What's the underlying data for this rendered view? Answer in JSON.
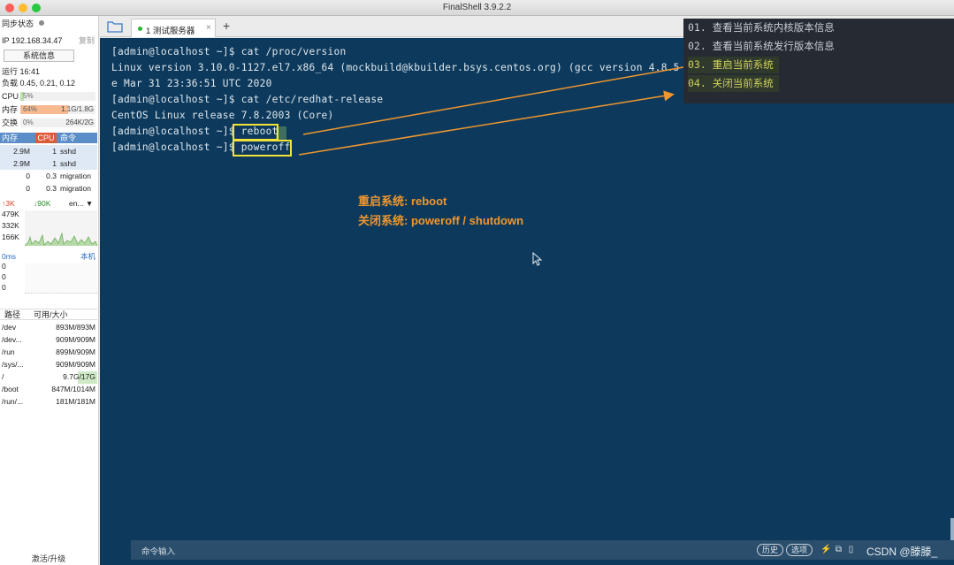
{
  "window": {
    "title": "FinalShell 3.9.2.2"
  },
  "sidebar": {
    "sync_status": "同步状态",
    "ip": "IP 192.168.34.47",
    "copy": "复制",
    "sysinfo_button": "系统信息",
    "uptime": "运行 16:41",
    "load": "负载 0.45, 0.21, 0.12",
    "cpu": {
      "label": "CPU",
      "pct": "5%",
      "value": 0.05
    },
    "mem": {
      "label": "内存",
      "pct": "64%",
      "amount": "1.1G/1.8G",
      "value": 0.64
    },
    "swap": {
      "label": "交换",
      "pct": "0%",
      "amount": "264K/2G",
      "value": 0.0
    },
    "proc_headers": [
      "内存",
      "CPU",
      "命令"
    ],
    "processes": [
      {
        "mem": "2.9M",
        "cpu": "1",
        "cmd": "sshd"
      },
      {
        "mem": "2.9M",
        "cpu": "1",
        "cmd": "sshd"
      },
      {
        "mem": "0",
        "cpu": "0.3",
        "cmd": "migration"
      },
      {
        "mem": "0",
        "cpu": "0.3",
        "cmd": "migration"
      }
    ],
    "net": {
      "up": "↑3K",
      "down": "↓90K",
      "iface": "en...",
      "levels": [
        "479K",
        "332K",
        "166K"
      ]
    },
    "ping": {
      "label": "0ms",
      "host": "本机",
      "levels": [
        "0",
        "0",
        "0"
      ]
    },
    "disk_headers": [
      "路径",
      "可用/大小"
    ],
    "disks": [
      {
        "path": "/dev",
        "size": "893M/893M"
      },
      {
        "path": "/dev...",
        "size": "909M/909M"
      },
      {
        "path": "/run",
        "size": "899M/909M"
      },
      {
        "path": "/sys/...",
        "size": "909M/909M"
      },
      {
        "path": "/",
        "size": "9.7G/17G"
      },
      {
        "path": "/boot",
        "size": "847M/1014M"
      },
      {
        "path": "/run/...",
        "size": "181M/181M"
      }
    ],
    "upgrade": "激活/升级"
  },
  "tabs": [
    {
      "label": "1 测试服务器",
      "status_color": "#2db52d"
    }
  ],
  "terminal": {
    "lines": [
      "[admin@localhost ~]$ cat /proc/version",
      "Linux version 3.10.0-1127.el7.x86_64 (mockbuild@kbuilder.bsys.centos.org) (gcc version 4.8.5 20",
      "e Mar 31 23:36:51 UTC 2020",
      "[admin@localhost ~]$ cat /etc/redhat-release",
      "CentOS Linux release 7.8.2003 (Core)",
      "[admin@localhost ~]$ reboot",
      "[admin@localhost ~]$ poweroff"
    ],
    "highlight_reboot": "reboot",
    "highlight_poweroff": "poweroff",
    "bg_color": "#0d3a5c"
  },
  "annotations": {
    "line1": "重启系统: reboot",
    "line2": "关闭系统: poweroff / shutdown",
    "color": "#f0962e"
  },
  "command_history": [
    {
      "label": "01. 查看当前系统内核版本信息",
      "highlighted": false
    },
    {
      "label": "02. 查看当前系统发行版本信息",
      "highlighted": false
    },
    {
      "label": "03. 重启当前系统",
      "highlighted": true
    },
    {
      "label": "04. 关闭当前系统",
      "highlighted": true
    }
  ],
  "command_bar": {
    "label": "命令输入",
    "history_button": "历史",
    "select_button": "选项",
    "watermark": "CSDN @滕滕_"
  }
}
